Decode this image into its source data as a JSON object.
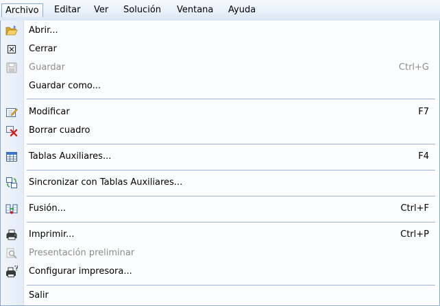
{
  "menubar": {
    "items": [
      "Archivo",
      "Editar",
      "Ver",
      "Solución",
      "Ventana",
      "Ayuda"
    ]
  },
  "menu": {
    "items": [
      {
        "label": "Abrir...",
        "shortcut": "",
        "icon": "folder-open-icon",
        "enabled": true
      },
      {
        "label": "Cerrar",
        "shortcut": "",
        "icon": "close-box-icon",
        "enabled": true
      },
      {
        "label": "Guardar",
        "shortcut": "Ctrl+G",
        "icon": "save-disk-icon",
        "enabled": false
      },
      {
        "label": "Guardar como...",
        "shortcut": "",
        "icon": "",
        "enabled": true
      },
      {
        "label": "Modificar",
        "shortcut": "F7",
        "icon": "edit-form-icon",
        "enabled": true
      },
      {
        "label": "Borrar cuadro",
        "shortcut": "",
        "icon": "delete-box-icon",
        "enabled": true
      },
      {
        "label": "Tablas Auxiliares...",
        "shortcut": "F4",
        "icon": "table-grid-icon",
        "enabled": true
      },
      {
        "label": "Sincronizar con Tablas Auxiliares...",
        "shortcut": "",
        "icon": "sync-tables-icon",
        "enabled": true
      },
      {
        "label": "Fusión...",
        "shortcut": "Ctrl+F",
        "icon": "merge-icon",
        "enabled": true
      },
      {
        "label": "Imprimir...",
        "shortcut": "Ctrl+P",
        "icon": "printer-icon",
        "enabled": true
      },
      {
        "label": "Presentación preliminar",
        "shortcut": "",
        "icon": "print-preview-icon",
        "enabled": false
      },
      {
        "label": "Configurar impresora...",
        "shortcut": "",
        "icon": "printer-setup-icon",
        "enabled": true
      },
      {
        "label": "Salir",
        "shortcut": "",
        "icon": "",
        "enabled": true
      }
    ]
  },
  "colors": {
    "menubar_bg": "#dbe7f6",
    "gutter_bg": "#e4ecf7",
    "separator": "#9fb5d3",
    "disabled_text": "#8d8d8d"
  }
}
